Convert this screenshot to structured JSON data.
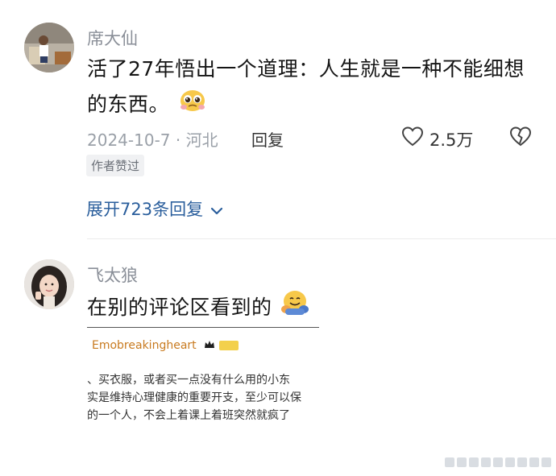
{
  "comments": [
    {
      "username": "席大仙",
      "content_line1": "活了27年悟出一个道理：人生就是一种不能细想",
      "content_line2": "的东西。",
      "emoji": "pleading-face-icon",
      "date_location": "2024-10-7 · 河北",
      "reply_label": "回复",
      "like_count": "2.5万",
      "badge": "作者赞过",
      "expand_label": "展开723条回复"
    },
    {
      "username": "飞太狼",
      "content": "在别的评论区看到的",
      "emoji": "hugging-face-icon",
      "embedded": {
        "username": "Emobreakingheart",
        "line1": "、买衣服，或者买一点没有什么用的小东",
        "line2": "实是维持心理健康的重要开支，至少可以保",
        "line3": "的一个人，不会上着课上着班突然就疯了"
      }
    }
  ],
  "colors": {
    "expand": "#2a5e9c",
    "meta": "#9aa0a8",
    "embed_user": "#c87a1f"
  }
}
